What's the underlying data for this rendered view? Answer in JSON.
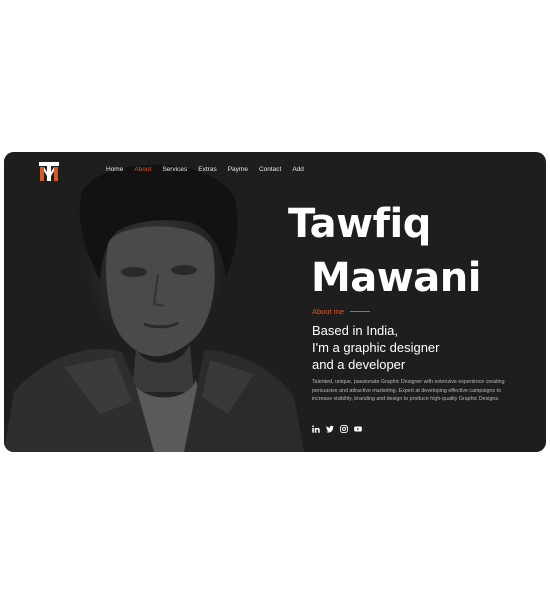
{
  "brand": {
    "logo_icon": "tm-monogram-logo-icon",
    "accent_color": "#d9581f",
    "background_color": "#1e1e1e"
  },
  "nav": {
    "items": [
      {
        "label": "Home"
      },
      {
        "label": "About",
        "active": true
      },
      {
        "label": "Services"
      },
      {
        "label": "Extras"
      },
      {
        "label": "Payme"
      },
      {
        "label": "Contact"
      },
      {
        "label": "Add"
      }
    ]
  },
  "hero": {
    "first_name": "Tawfiq",
    "last_name": "Mawani",
    "about_label": "About me",
    "headline_lines": [
      "Based in India,",
      "I'm a graphic designer",
      "and a developer"
    ],
    "bio": "Talented, unique, passionate Graphic Designer with extensive experience creating persuasive and attractive marketing. Expert at developing effective campaigns to increase visibility, branding and design to produce high-quality Graphic Designs.",
    "portrait": "grayscale-portrait-photo"
  },
  "socials": [
    {
      "icon": "linkedin-icon"
    },
    {
      "icon": "twitter-icon"
    },
    {
      "icon": "instagram-icon"
    },
    {
      "icon": "youtube-icon"
    }
  ]
}
